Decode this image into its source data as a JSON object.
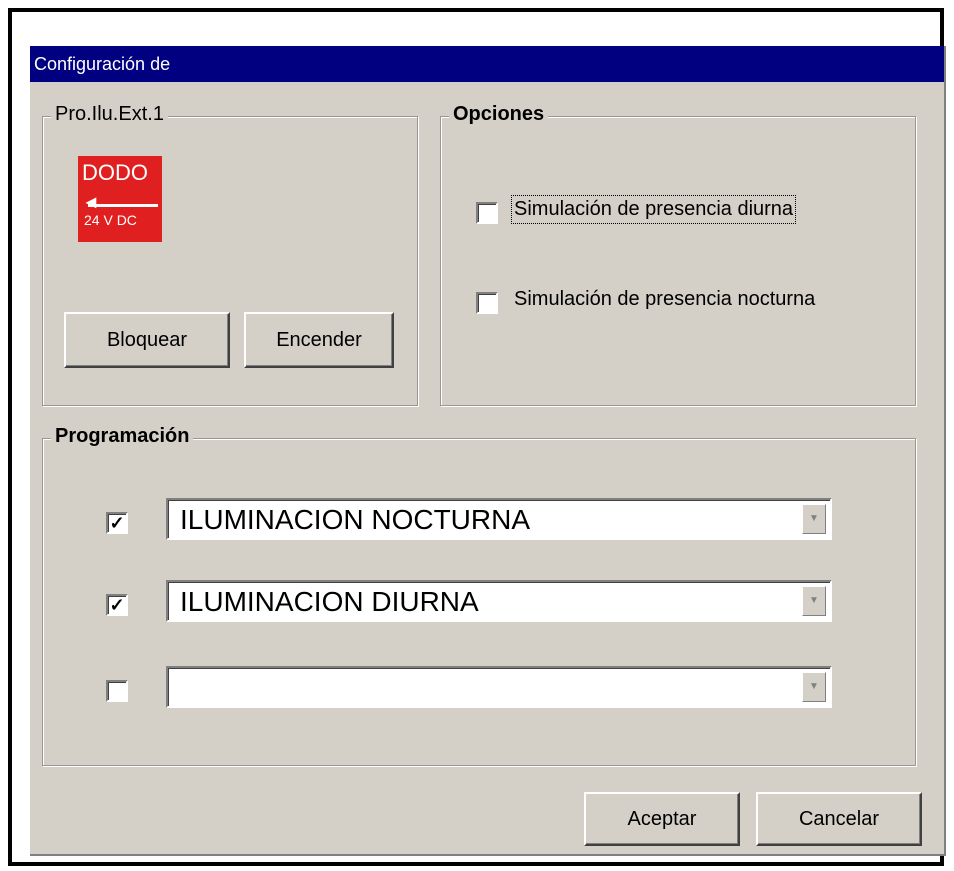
{
  "window": {
    "title": "Configuración de"
  },
  "device_group": {
    "label": "Pro.Ilu.Ext.1",
    "icon": {
      "name": "output-device-icon",
      "top_text": "DODO",
      "bottom_text": "24 V DC",
      "color": "#e02020"
    },
    "block_button": "Bloquear",
    "on_button": "Encender"
  },
  "options": {
    "label": "Opciones",
    "items": [
      {
        "label": "Simulación de presencia diurna",
        "checked": false
      },
      {
        "label": "Simulación de presencia nocturna",
        "checked": false
      }
    ]
  },
  "programming": {
    "label": "Programación",
    "rows": [
      {
        "checked": true,
        "value": "ILUMINACION NOCTURNA"
      },
      {
        "checked": true,
        "value": "ILUMINACION DIURNA"
      },
      {
        "checked": false,
        "value": ""
      }
    ]
  },
  "footer": {
    "accept": "Aceptar",
    "cancel": "Cancelar"
  },
  "colors": {
    "titlebar": "#000080",
    "dialog_bg": "#d4d0c8"
  }
}
